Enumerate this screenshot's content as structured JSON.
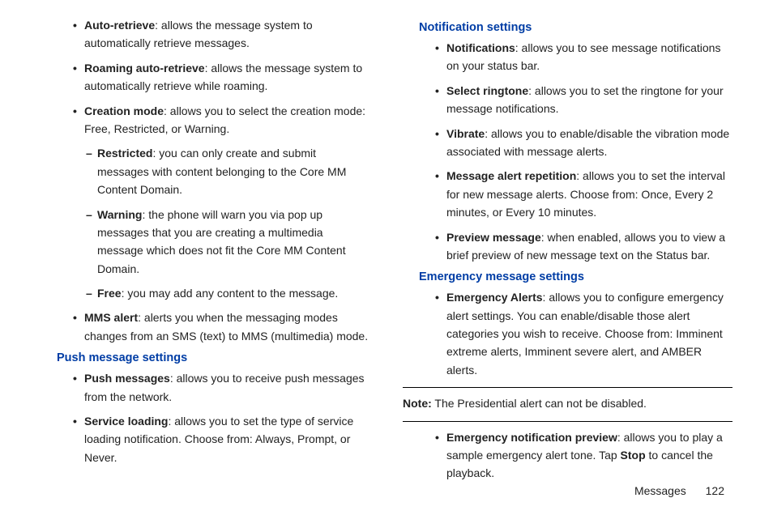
{
  "col1": {
    "items_top": [
      {
        "term": "Auto-retrieve",
        "desc": ": allows the message system to automatically retrieve messages."
      },
      {
        "term": "Roaming auto-retrieve",
        "desc": ": allows the message system to automatically retrieve while roaming."
      },
      {
        "term": "Creation mode",
        "desc": ": allows you to select the creation mode: Free, Restricted, or Warning."
      }
    ],
    "sub_items": [
      {
        "term": "Restricted",
        "desc": ": you can only create and submit messages with content belonging to the Core MM Content Domain."
      },
      {
        "term": "Warning",
        "desc": ": the phone will warn you via pop up messages that you are creating a multimedia message which does not fit the Core MM Content Domain."
      },
      {
        "term": "Free",
        "desc": ": you may add any content to the message."
      }
    ],
    "mms_alert": {
      "term": "MMS alert",
      "desc": ": alerts you when the messaging modes changes from an SMS (text) to MMS (multimedia) mode."
    },
    "push_heading": "Push message settings",
    "push_items": [
      {
        "term": "Push messages",
        "desc": ": allows you to receive push messages from the network."
      },
      {
        "term": "Service loading",
        "desc": ": allows you to set the type of service loading notification. Choose from: Always, Prompt, or Never."
      }
    ]
  },
  "col2": {
    "notif_heading": "Notification settings",
    "notif_items": [
      {
        "term": "Notifications",
        "desc": ": allows you to see message notifications on your status bar."
      },
      {
        "term": "Select ringtone",
        "desc": ": allows you to set the ringtone for your message notifications."
      },
      {
        "term": "Vibrate",
        "desc": ": allows you to enable/disable the vibration mode associated with message alerts."
      },
      {
        "term": "Message alert repetition",
        "desc": ": allows you to set the interval for new message alerts. Choose from: Once, Every 2 minutes, or Every 10 minutes."
      },
      {
        "term": "Preview message",
        "desc": ": when enabled, allows you to view a brief preview of new message text on the Status bar."
      }
    ],
    "emerg_heading": "Emergency message settings",
    "emerg_item1": {
      "term": "Emergency Alerts",
      "desc": ": allows you to configure emergency alert settings. You can enable/disable those alert categories you wish to receive. Choose from: Imminent extreme alerts, Imminent severe alert, and AMBER alerts."
    },
    "note_label": "Note:",
    "note_text": " The Presidential alert can not be disabled.",
    "emerg_item2_term": "Emergency notification preview",
    "emerg_item2_pre": ": allows you to play a sample emergency alert tone. Tap ",
    "emerg_item2_stop": "Stop",
    "emerg_item2_post": " to cancel the playback."
  },
  "footer": {
    "section": "Messages",
    "page": "122"
  }
}
